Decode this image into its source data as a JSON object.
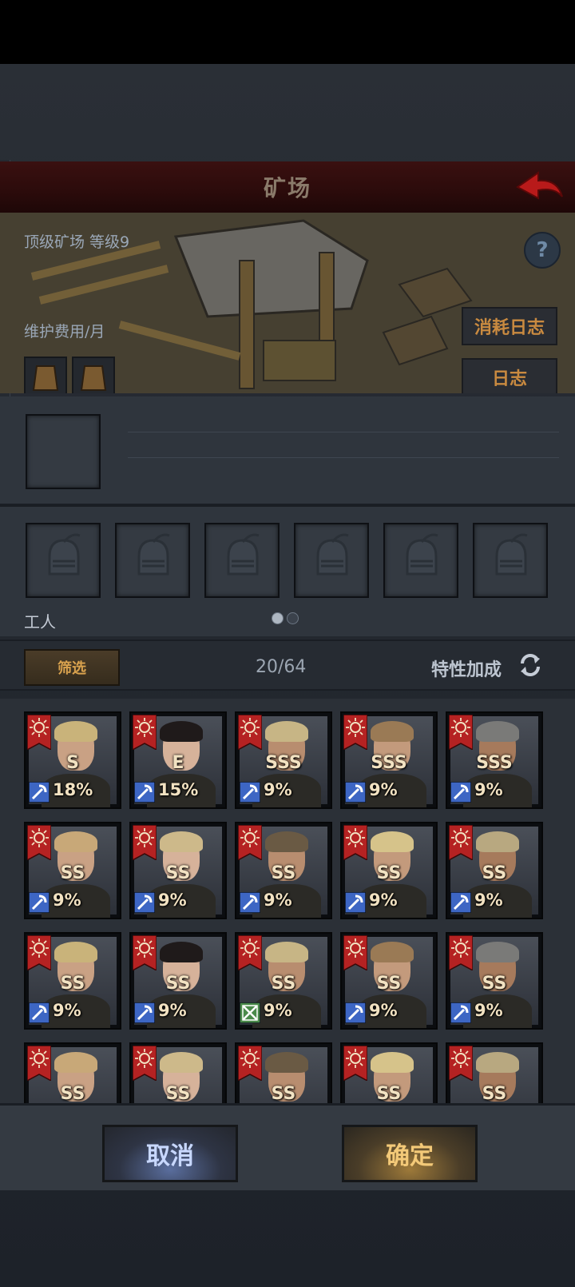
{
  "header": {
    "title": "矿场"
  },
  "banner": {
    "facility": "顶级矿场 等级9",
    "maintenance": "维护费用/月",
    "help_symbol": "?",
    "consume_log": "消耗日志",
    "log": "日志"
  },
  "workers": {
    "label": "工人",
    "page_dots": 2,
    "active_dot": 0
  },
  "filter": {
    "button": "筛选",
    "count": "20/64",
    "trait_bonus": "特性加成"
  },
  "characters": [
    {
      "grade": "S",
      "bonus": "18%",
      "tool": "pickaxe"
    },
    {
      "grade": "E",
      "bonus": "15%",
      "tool": "pickaxe"
    },
    {
      "grade": "SSS",
      "bonus": "9%",
      "tool": "pickaxe"
    },
    {
      "grade": "SSS",
      "bonus": "9%",
      "tool": "pickaxe"
    },
    {
      "grade": "SSS",
      "bonus": "9%",
      "tool": "pickaxe"
    },
    {
      "grade": "SS",
      "bonus": "9%",
      "tool": "pickaxe"
    },
    {
      "grade": "SS",
      "bonus": "9%",
      "tool": "pickaxe"
    },
    {
      "grade": "SS",
      "bonus": "9%",
      "tool": "pickaxe"
    },
    {
      "grade": "SS",
      "bonus": "9%",
      "tool": "pickaxe"
    },
    {
      "grade": "SS",
      "bonus": "9%",
      "tool": "pickaxe"
    },
    {
      "grade": "SS",
      "bonus": "9%",
      "tool": "pickaxe"
    },
    {
      "grade": "SS",
      "bonus": "9%",
      "tool": "pickaxe"
    },
    {
      "grade": "SS",
      "bonus": "9%",
      "tool": "crossed-tools"
    },
    {
      "grade": "SS",
      "bonus": "9%",
      "tool": "pickaxe"
    },
    {
      "grade": "SS",
      "bonus": "9%",
      "tool": "pickaxe"
    },
    {
      "grade": "SS",
      "bonus": "",
      "tool": "pickaxe"
    },
    {
      "grade": "SS",
      "bonus": "",
      "tool": "pickaxe"
    },
    {
      "grade": "SS",
      "bonus": "",
      "tool": "pickaxe"
    },
    {
      "grade": "SS",
      "bonus": "",
      "tool": "pickaxe"
    },
    {
      "grade": "SS",
      "bonus": "",
      "tool": "pickaxe"
    }
  ],
  "actions": {
    "cancel": "取消",
    "confirm": "确定"
  },
  "colors": {
    "title_bar": "#2b0b0b",
    "back_arrow": "#b81a1a",
    "flag": "#b52222",
    "pickaxe_badge": "#3d66c4",
    "crossed_badge": "#4a8a4a",
    "confirm_text": "#f3c978",
    "cancel_text": "#c8d8ff"
  }
}
